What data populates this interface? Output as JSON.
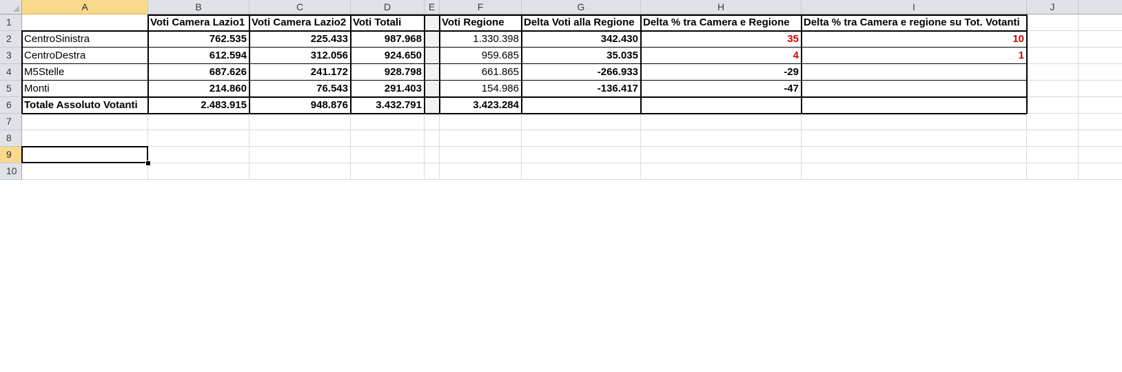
{
  "columns": [
    "A",
    "B",
    "C",
    "D",
    "E",
    "F",
    "G",
    "H",
    "I",
    "J"
  ],
  "rows": [
    "1",
    "2",
    "3",
    "4",
    "5",
    "6",
    "7",
    "8",
    "9",
    "10"
  ],
  "selected": {
    "column": "A",
    "row": "9"
  },
  "header_row": [
    "",
    "Voti Camera Lazio1",
    "Voti Camera Lazio2",
    "Voti Totali",
    "",
    "Voti Regione",
    "Delta Voti alla Regione",
    "Delta % tra Camera e Regione",
    "Delta % tra Camera e regione su Tot. Votanti",
    ""
  ],
  "data_rows": [
    [
      "CentroSinistra",
      "762.535",
      "225.433",
      "987.968",
      "",
      "1.330.398",
      "342.430",
      "35",
      "10",
      ""
    ],
    [
      "CentroDestra",
      "612.594",
      "312.056",
      "924.650",
      "",
      "959.685",
      "35.035",
      "4",
      "1",
      ""
    ],
    [
      "M5Stelle",
      "687.626",
      "241.172",
      "928.798",
      "",
      "661.865",
      "-266.933",
      "-29",
      "",
      ""
    ],
    [
      "Monti",
      "214.860",
      "76.543",
      "291.403",
      "",
      "154.986",
      "-136.417",
      "-47",
      "",
      ""
    ],
    [
      "Totale Assoluto Votanti",
      "2.483.915",
      "948.876",
      "3.432.791",
      "",
      "3.423.284",
      "",
      "",
      "",
      ""
    ]
  ],
  "colors": {
    "negative_highlight": "#d40000",
    "selected_header": "#f9d98b",
    "header_bg": "#dfe3e8"
  }
}
